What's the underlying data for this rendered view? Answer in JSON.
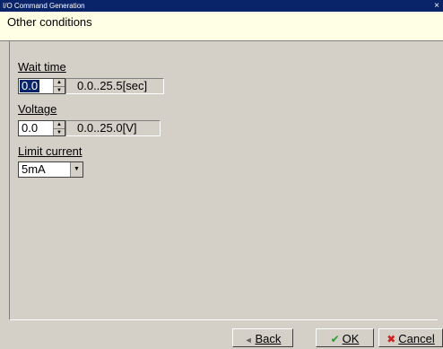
{
  "window": {
    "title": "I/O Command Generation",
    "close_glyph": "×"
  },
  "header": {
    "title": "Other conditions"
  },
  "wait_time": {
    "label": "Wait time",
    "value": "0.0",
    "range": "0.0..25.5[sec]"
  },
  "voltage": {
    "label": "Voltage",
    "value": "0.0",
    "range": "0.0..25.0[V]"
  },
  "limit_current": {
    "label": "Limit current",
    "value": "5mA"
  },
  "buttons": {
    "back": {
      "label": "Back",
      "icon": "◄"
    },
    "ok": {
      "label": "OK",
      "icon": "✔"
    },
    "cancel": {
      "label": "Cancel",
      "icon": "✖"
    }
  },
  "colors": {
    "header_bg": "#ffffe6",
    "titlebar_bg": "#0a246a",
    "ok_icon": "#2e9b2e",
    "cancel_icon": "#d02020"
  }
}
